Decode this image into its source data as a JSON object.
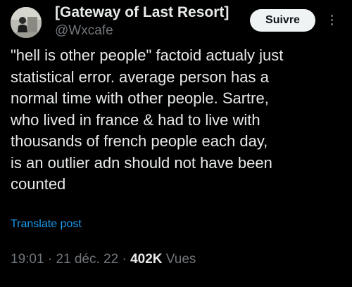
{
  "author": {
    "display_name": "[Gateway of Last Resort]",
    "handle": "@Wxcafe"
  },
  "follow_button_label": "Suivre",
  "more_icon": "more-vertical-icon",
  "tweet": {
    "lines": [
      "\"hell is other people\" factoid actualy just",
      "statistical error. average person has a",
      "normal time with other people. Sartre,",
      "who lived in france & had to live with",
      "thousands of french people each day,",
      "is an outlier adn should not have been",
      "counted"
    ]
  },
  "translate_label": "Translate post",
  "meta": {
    "time": "19:01",
    "separator": "·",
    "date": "21 déc. 22",
    "views_count": "402K",
    "views_label": "Vues"
  },
  "colors": {
    "background": "#000000",
    "text_primary": "#e7e9ea",
    "text_secondary": "#71767b",
    "link": "#1d9bf0",
    "button_bg": "#eff3f4"
  }
}
